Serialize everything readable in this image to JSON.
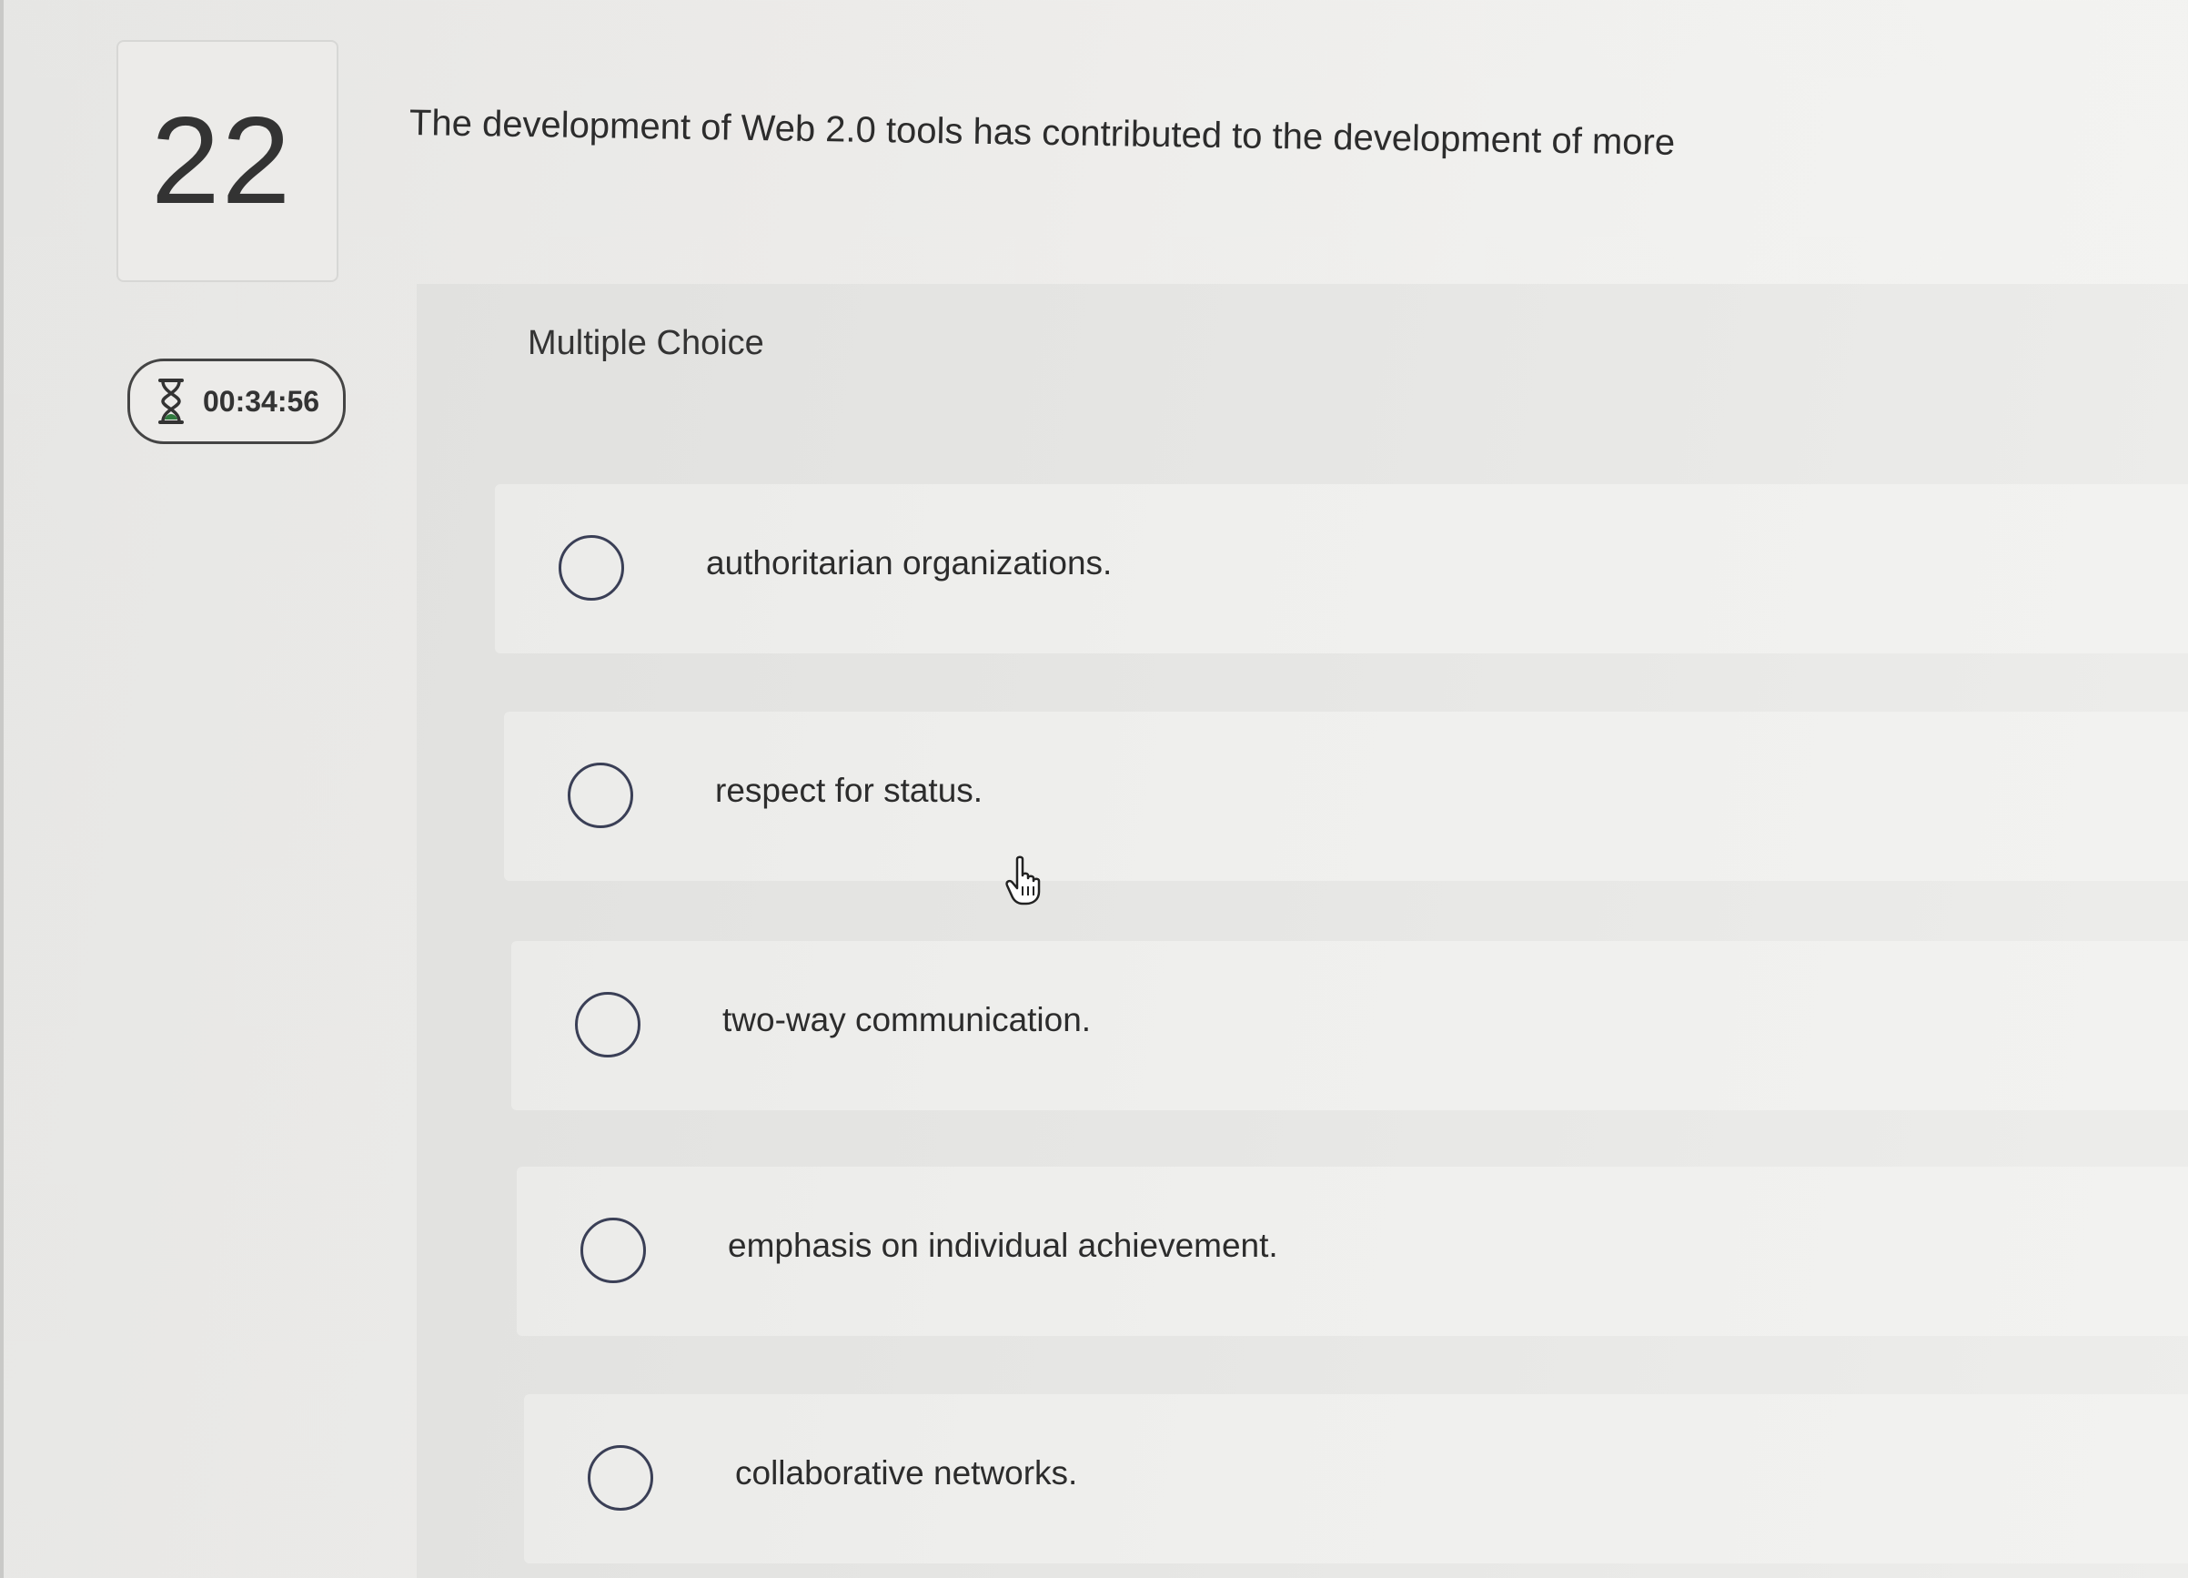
{
  "question": {
    "number": "22",
    "text": "The development of Web 2.0 tools has contributed to the development of more"
  },
  "timer": {
    "icon": "hourglass-icon",
    "value": "00:34:56"
  },
  "answer_panel": {
    "type_label": "Multiple Choice",
    "options": [
      {
        "label": "authoritarian organizations.",
        "selected": false
      },
      {
        "label": "respect for status.",
        "selected": false
      },
      {
        "label": "two-way communication.",
        "selected": false
      },
      {
        "label": "emphasis on individual achievement.",
        "selected": false
      },
      {
        "label": "collaborative networks.",
        "selected": false
      }
    ]
  },
  "colors": {
    "radio_border": "#3a3f56",
    "text": "#2c2c2c",
    "background": "#ecebe9"
  }
}
